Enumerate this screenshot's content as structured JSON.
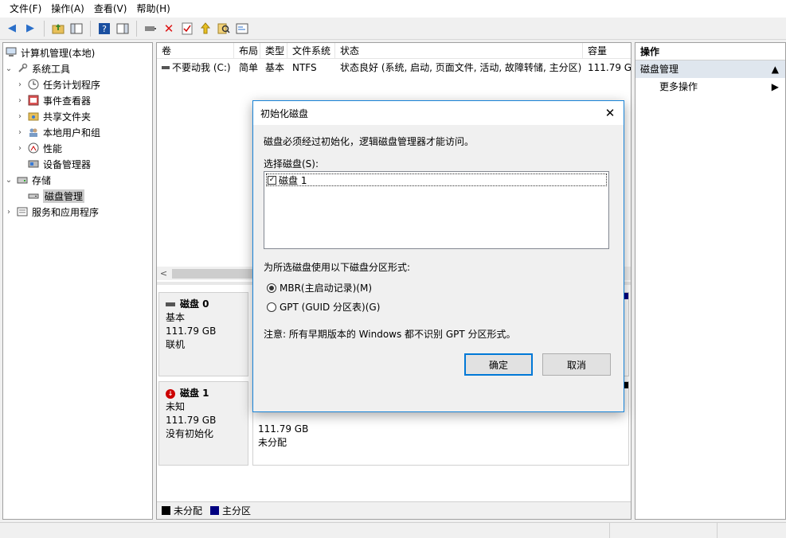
{
  "menu": [
    "文件(F)",
    "操作(A)",
    "查看(V)",
    "帮助(H)"
  ],
  "toolbar_icons": [
    "back-icon",
    "forward-icon",
    "up-folder-icon",
    "show-hide-tree-icon",
    "help-icon",
    "show-hide-action-icon",
    "connect-icon",
    "delete-icon",
    "properties-icon",
    "folder-up-icon",
    "search-icon",
    "settings-icon"
  ],
  "tree": {
    "root": "计算机管理(本地)",
    "system_tools": "系统工具",
    "task_scheduler": "任务计划程序",
    "event_viewer": "事件查看器",
    "shared_folders": "共享文件夹",
    "local_users": "本地用户和组",
    "performance": "性能",
    "device_manager": "设备管理器",
    "storage": "存储",
    "disk_management": "磁盘管理",
    "services": "服务和应用程序"
  },
  "volumes": {
    "headers": [
      "卷",
      "布局",
      "类型",
      "文件系统",
      "状态",
      "容量"
    ],
    "row": [
      "不要动我 (C:)",
      "简单",
      "基本",
      "NTFS",
      "状态良好 (系统, 启动, 页面文件, 活动, 故障转储, 主分区)",
      "111.79 G"
    ]
  },
  "disks": [
    {
      "name": "磁盘 0",
      "type": "基本",
      "size": "111.79 GB",
      "status": "联机"
    },
    {
      "name": "磁盘 1",
      "type": "未知",
      "size": "111.79 GB",
      "status": "没有初始化",
      "area_size": "111.79 GB",
      "area_status": "未分配"
    }
  ],
  "legend": {
    "unallocated": "未分配",
    "primary": "主分区"
  },
  "actions": {
    "header": "操作",
    "section": "磁盘管理",
    "more": "更多操作"
  },
  "dialog": {
    "title": "初始化磁盘",
    "message": "磁盘必须经过初始化，逻辑磁盘管理器才能访问。",
    "select_label": "选择磁盘(S):",
    "disk_item": "磁盘 1",
    "style_label": "为所选磁盘使用以下磁盘分区形式:",
    "mbr": "MBR(主启动记录)(M)",
    "gpt": "GPT (GUID 分区表)(G)",
    "note": "注意: 所有早期版本的 Windows 都不识别 GPT 分区形式。",
    "ok": "确定",
    "cancel": "取消"
  },
  "colors": {
    "unallocated": "#000000",
    "primary": "#000080",
    "accent": "#0078d7"
  }
}
